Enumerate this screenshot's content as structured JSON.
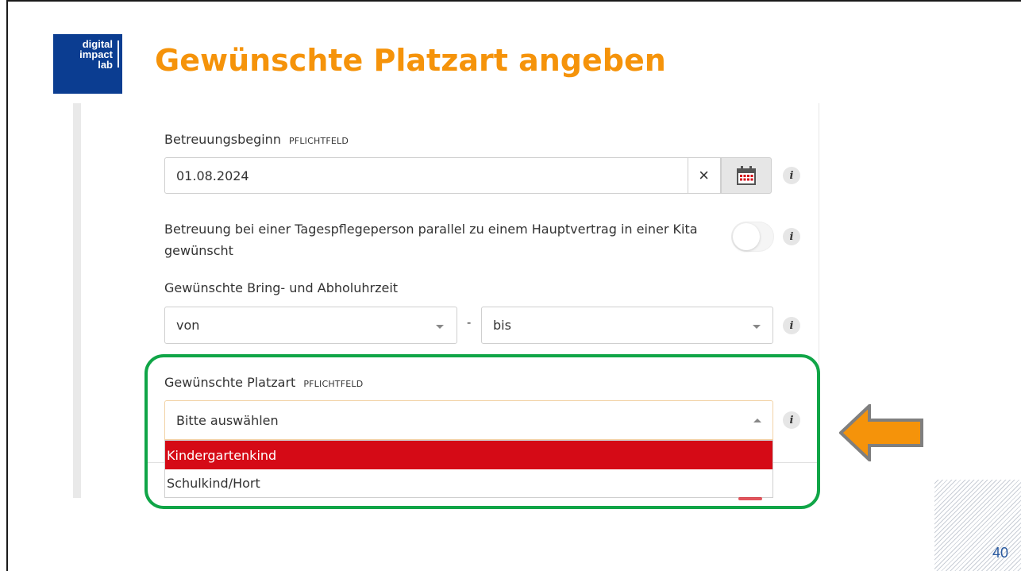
{
  "slide": {
    "title": "Gewünschte Platzart angeben",
    "page_number": "40",
    "logo": {
      "lines": [
        "digital",
        "impact",
        "lab"
      ]
    }
  },
  "form": {
    "start": {
      "label": "Betreuungsbeginn",
      "required": "PFLICHTFELD",
      "value": "01.08.2024",
      "clear_symbol": "×"
    },
    "parallel": {
      "label_line1": "Betreuung bei einer Tagespflegeperson parallel zu einem Hauptvertrag in einer Kita",
      "label_line2": "gewünscht",
      "toggle_on": false
    },
    "times": {
      "label": "Gewünschte Bring- und Abholuhrzeit",
      "from_value": "von",
      "separator": "-",
      "to_value": "bis"
    },
    "type": {
      "label": "Gewünschte Platzart",
      "required": "PFLICHTFELD",
      "placeholder": "Bitte auswählen",
      "options": [
        "Kindergartenkind",
        "Schulkind/Hort"
      ],
      "highlighted_option": "Kindergartenkind"
    },
    "info_symbol": "i"
  },
  "colors": {
    "title": "#f5930a",
    "logo_bg": "#0b3d91",
    "highlight_frame": "#10a547",
    "selected_option": "#d50a16",
    "arrow": "#f5930a"
  }
}
